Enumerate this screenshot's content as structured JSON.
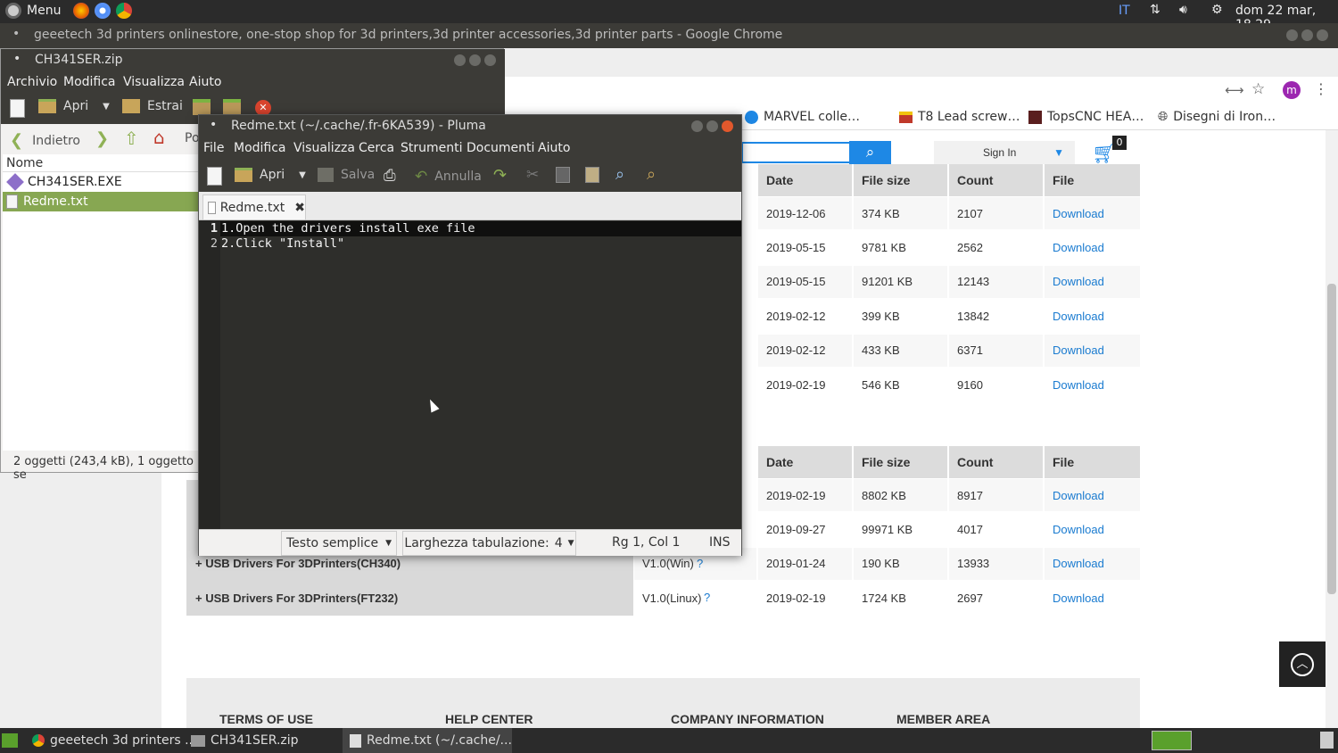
{
  "top_panel": {
    "menu": "Menu",
    "keyboard": "IT",
    "clock": "dom 22 mar, 18.29"
  },
  "chrome": {
    "window_title": "geeetech 3d printers onlinestore, one-stop shop for 3d printers,3d printer accessories,3d printer parts - Google Chrome",
    "profile_initial": "m",
    "bookmarks": [
      "MARVEL colle…",
      "T8 Lead screw…",
      "TopsCNC HEA…",
      "Disegni di Iron…"
    ],
    "sign_in": "Sign In",
    "cart_count": "0",
    "table1": {
      "headers": [
        "Date",
        "File size",
        "Count",
        "File"
      ],
      "rows": [
        [
          "2019-12-06",
          "374 KB",
          "2107",
          "Download"
        ],
        [
          "2019-05-15",
          "9781 KB",
          "2562",
          "Download"
        ],
        [
          "2019-05-15",
          "91201 KB",
          "12143",
          "Download"
        ],
        [
          "2019-02-12",
          "399 KB",
          "13842",
          "Download"
        ],
        [
          "2019-02-12",
          "433 KB",
          "6371",
          "Download"
        ],
        [
          "2019-02-19",
          "546 KB",
          "9160",
          "Download"
        ]
      ]
    },
    "table2": {
      "headers": [
        "Date",
        "File size",
        "Count",
        "File"
      ],
      "rows": [
        [
          "",
          "",
          "2019-02-19",
          "8802 KB",
          "8917",
          "Download"
        ],
        [
          "",
          "",
          "2019-09-27",
          "99971 KB",
          "4017",
          "Download"
        ],
        [
          "+ USB Drivers For 3DPrinters(CH340)",
          "V1.0(Win)",
          "2019-01-24",
          "190 KB",
          "13933",
          "Download"
        ],
        [
          "+ USB Drivers For 3DPrinters(FT232)",
          "V1.0(Linux)",
          "2019-02-19",
          "1724 KB",
          "2697",
          "Download"
        ]
      ]
    },
    "footer": [
      "TERMS OF USE",
      "HELP CENTER",
      "COMPANY INFORMATION",
      "MEMBER AREA"
    ]
  },
  "archive": {
    "title": "CH341SER.zip",
    "menu": [
      "Archivio",
      "Modifica",
      "Visualizza",
      "Aiuto"
    ],
    "toolbar": {
      "open": "Apri",
      "extract": "Estrai"
    },
    "nav": {
      "back": "Indietro",
      "location": "Po"
    },
    "column": "Nome",
    "files": [
      "CH341SER.EXE",
      "Redme.txt"
    ],
    "status": "2 oggetti (243,4 kB), 1 oggetto se"
  },
  "pluma": {
    "title": "Redme.txt (~/.cache/.fr-6KA539) - Pluma",
    "menu": [
      "File",
      "Modifica",
      "Visualizza",
      "Cerca",
      "Strumenti",
      "Documenti",
      "Aiuto"
    ],
    "toolbar": {
      "open": "Apri",
      "save": "Salva",
      "undo": "Annulla"
    },
    "tab": "Redme.txt",
    "lines": [
      "1.Open the drivers install exe file",
      "2.Click \"Install\""
    ],
    "line_numbers": [
      "1",
      "2"
    ],
    "status": {
      "syntax": "Testo semplice",
      "tab_width": "Larghezza tabulazione:",
      "tab_width_value": "4",
      "position": "Rg 1, Col 1",
      "mode": "INS"
    }
  },
  "taskbar": [
    "geeetech 3d printers ...",
    "CH341SER.zip",
    "Redme.txt (~/.cache/..."
  ]
}
